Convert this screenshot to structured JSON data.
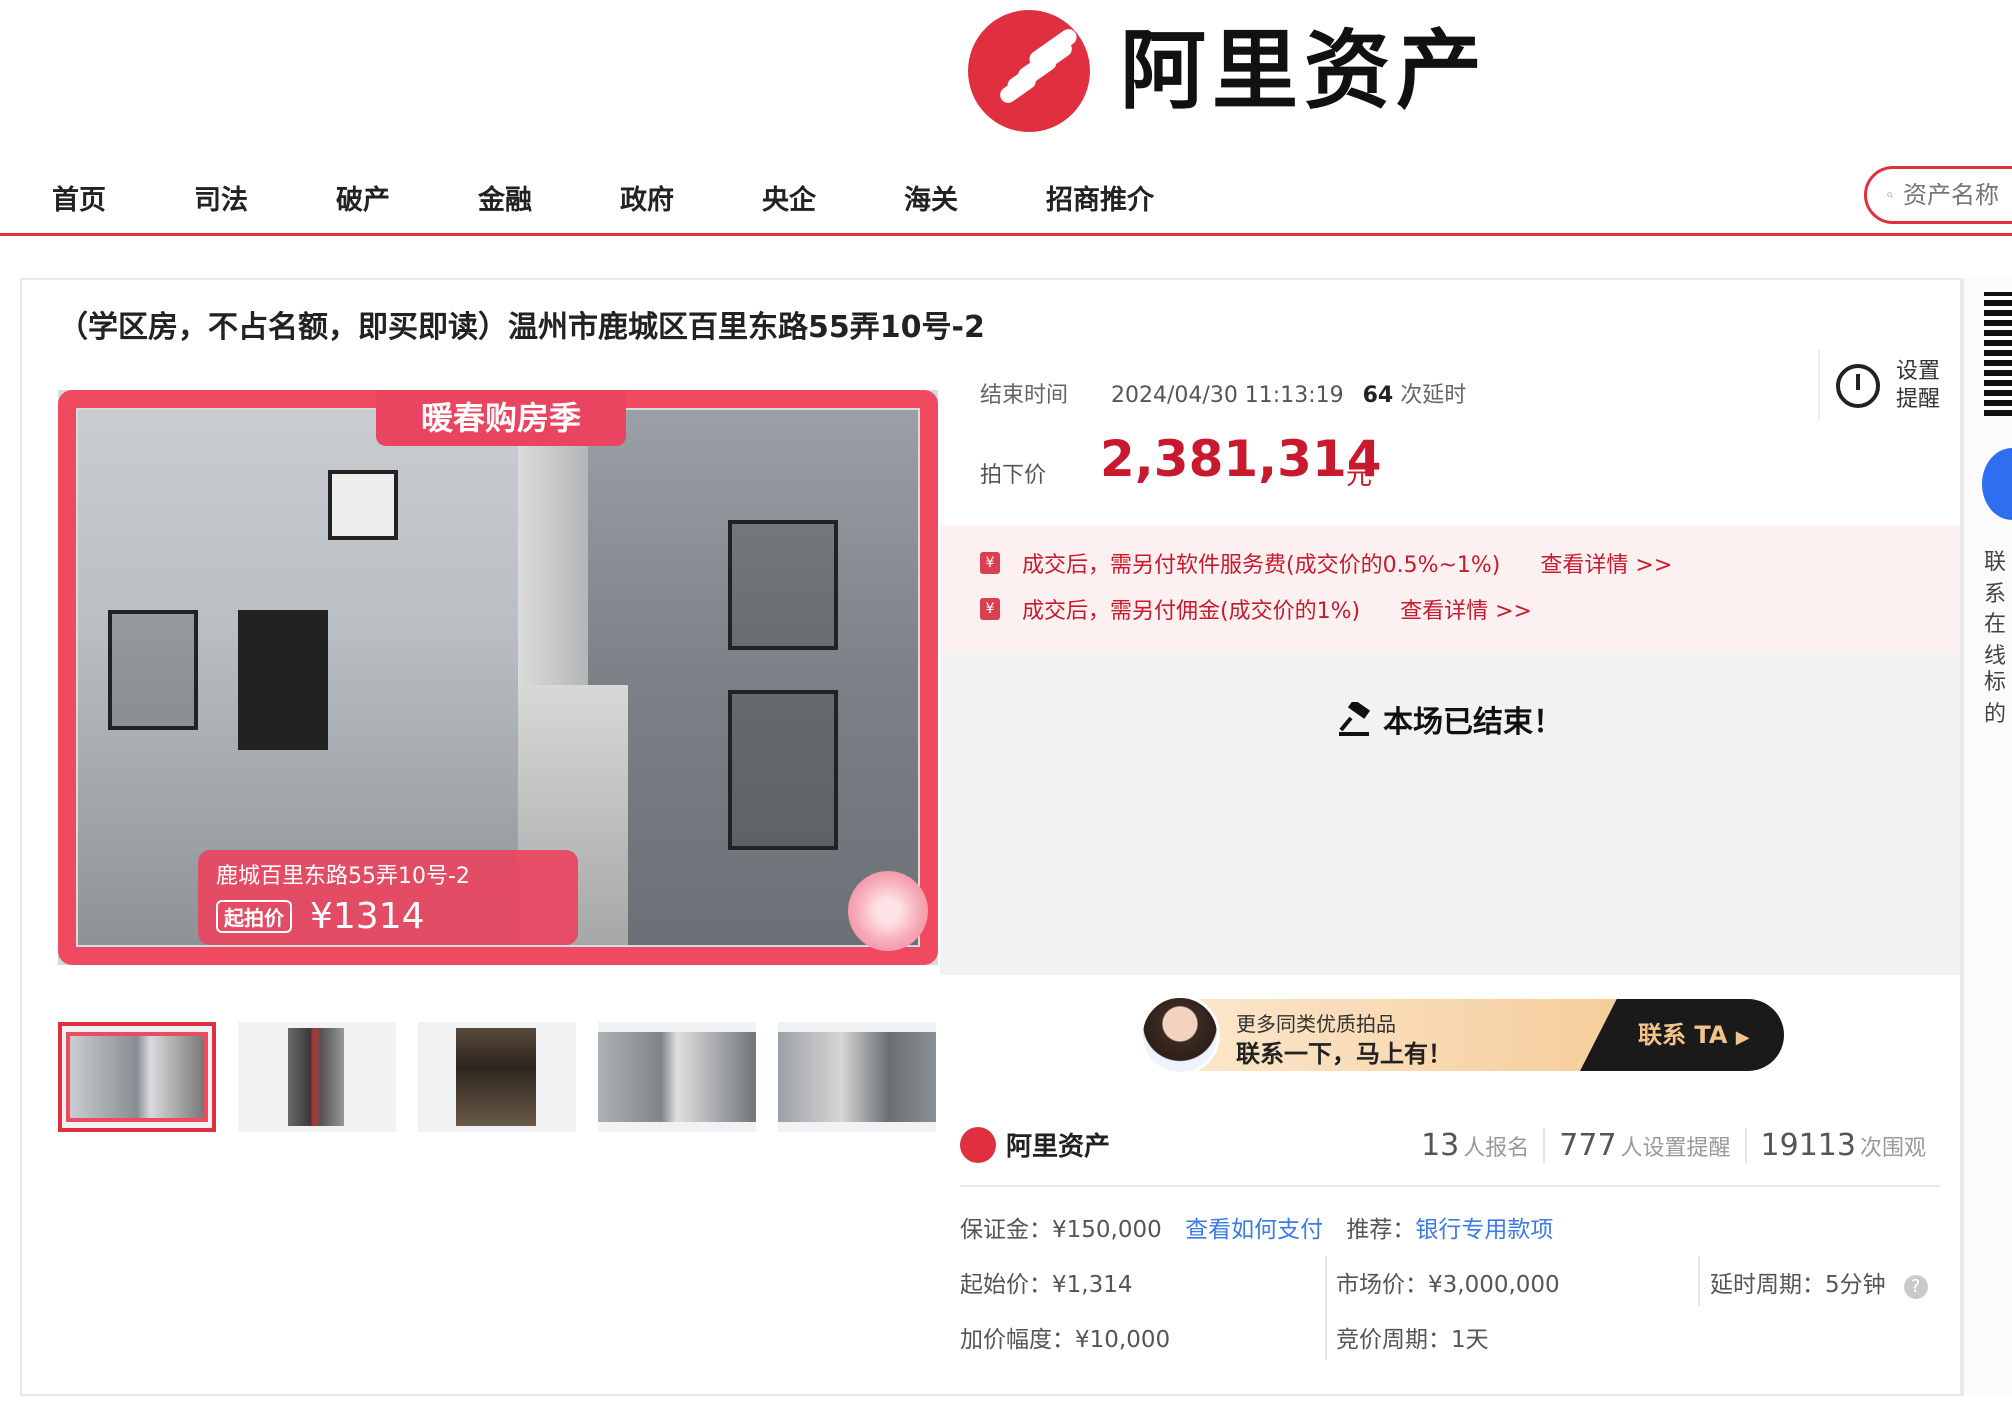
{
  "brand": {
    "name": "阿里资产",
    "color": "#e0303f"
  },
  "nav": {
    "items": [
      "首页",
      "司法",
      "破产",
      "金融",
      "政府",
      "央企",
      "海关",
      "招商推介"
    ],
    "search_placeholder": "资产名称"
  },
  "listing": {
    "title": "（学区房，不占名额，即买即读）温州市鹿城区百里东路55弄10号-2",
    "photo": {
      "banner": "暖春购房季",
      "address": "鹿城百里东路55弄10号-2",
      "start_tag": "起拍价",
      "start_price": "¥1314"
    },
    "thumbnail_count": 5,
    "end": {
      "label": "结束时间",
      "time": "2024/04/30 11:13:19",
      "extensions": "64",
      "extensions_suffix": "次延时"
    },
    "remind": {
      "line1": "设置",
      "line2": "提醒"
    },
    "final_price": {
      "label": "拍下价",
      "value": "2,381,314",
      "unit": "元"
    },
    "fees": [
      {
        "text": "成交后，需另付软件服务费(成交价的0.5%~1%)",
        "link": "查看详情 >>"
      },
      {
        "text": "成交后，需另付佣金(成交价的1%)",
        "link": "查看详情 >>"
      }
    ],
    "status": "本场已结束！",
    "contact": {
      "line1": "更多同类优质拍品",
      "line2": "联系一下，马上有！",
      "button": "联系 TA"
    },
    "org": {
      "name": "阿里资产"
    },
    "stats": [
      {
        "value": "13",
        "label": "人报名"
      },
      {
        "value": "777",
        "label": "人设置提醒"
      },
      {
        "value": "19113",
        "label": "次围观"
      }
    ],
    "info": {
      "deposit": "保证金：¥150,000",
      "pay_link": "查看如何支付",
      "recommend_label": "推荐：",
      "recommend_link": "银行专用款项",
      "start_price": "起始价：¥1,314",
      "market_price": "市场价：¥3,000,000",
      "delay_period": "延时周期：5分钟",
      "increment": "加价幅度：¥10,000",
      "bid_period": "竞价周期：1天"
    }
  },
  "sidebar": {
    "items": [
      "联系",
      "在线",
      "标的"
    ]
  }
}
